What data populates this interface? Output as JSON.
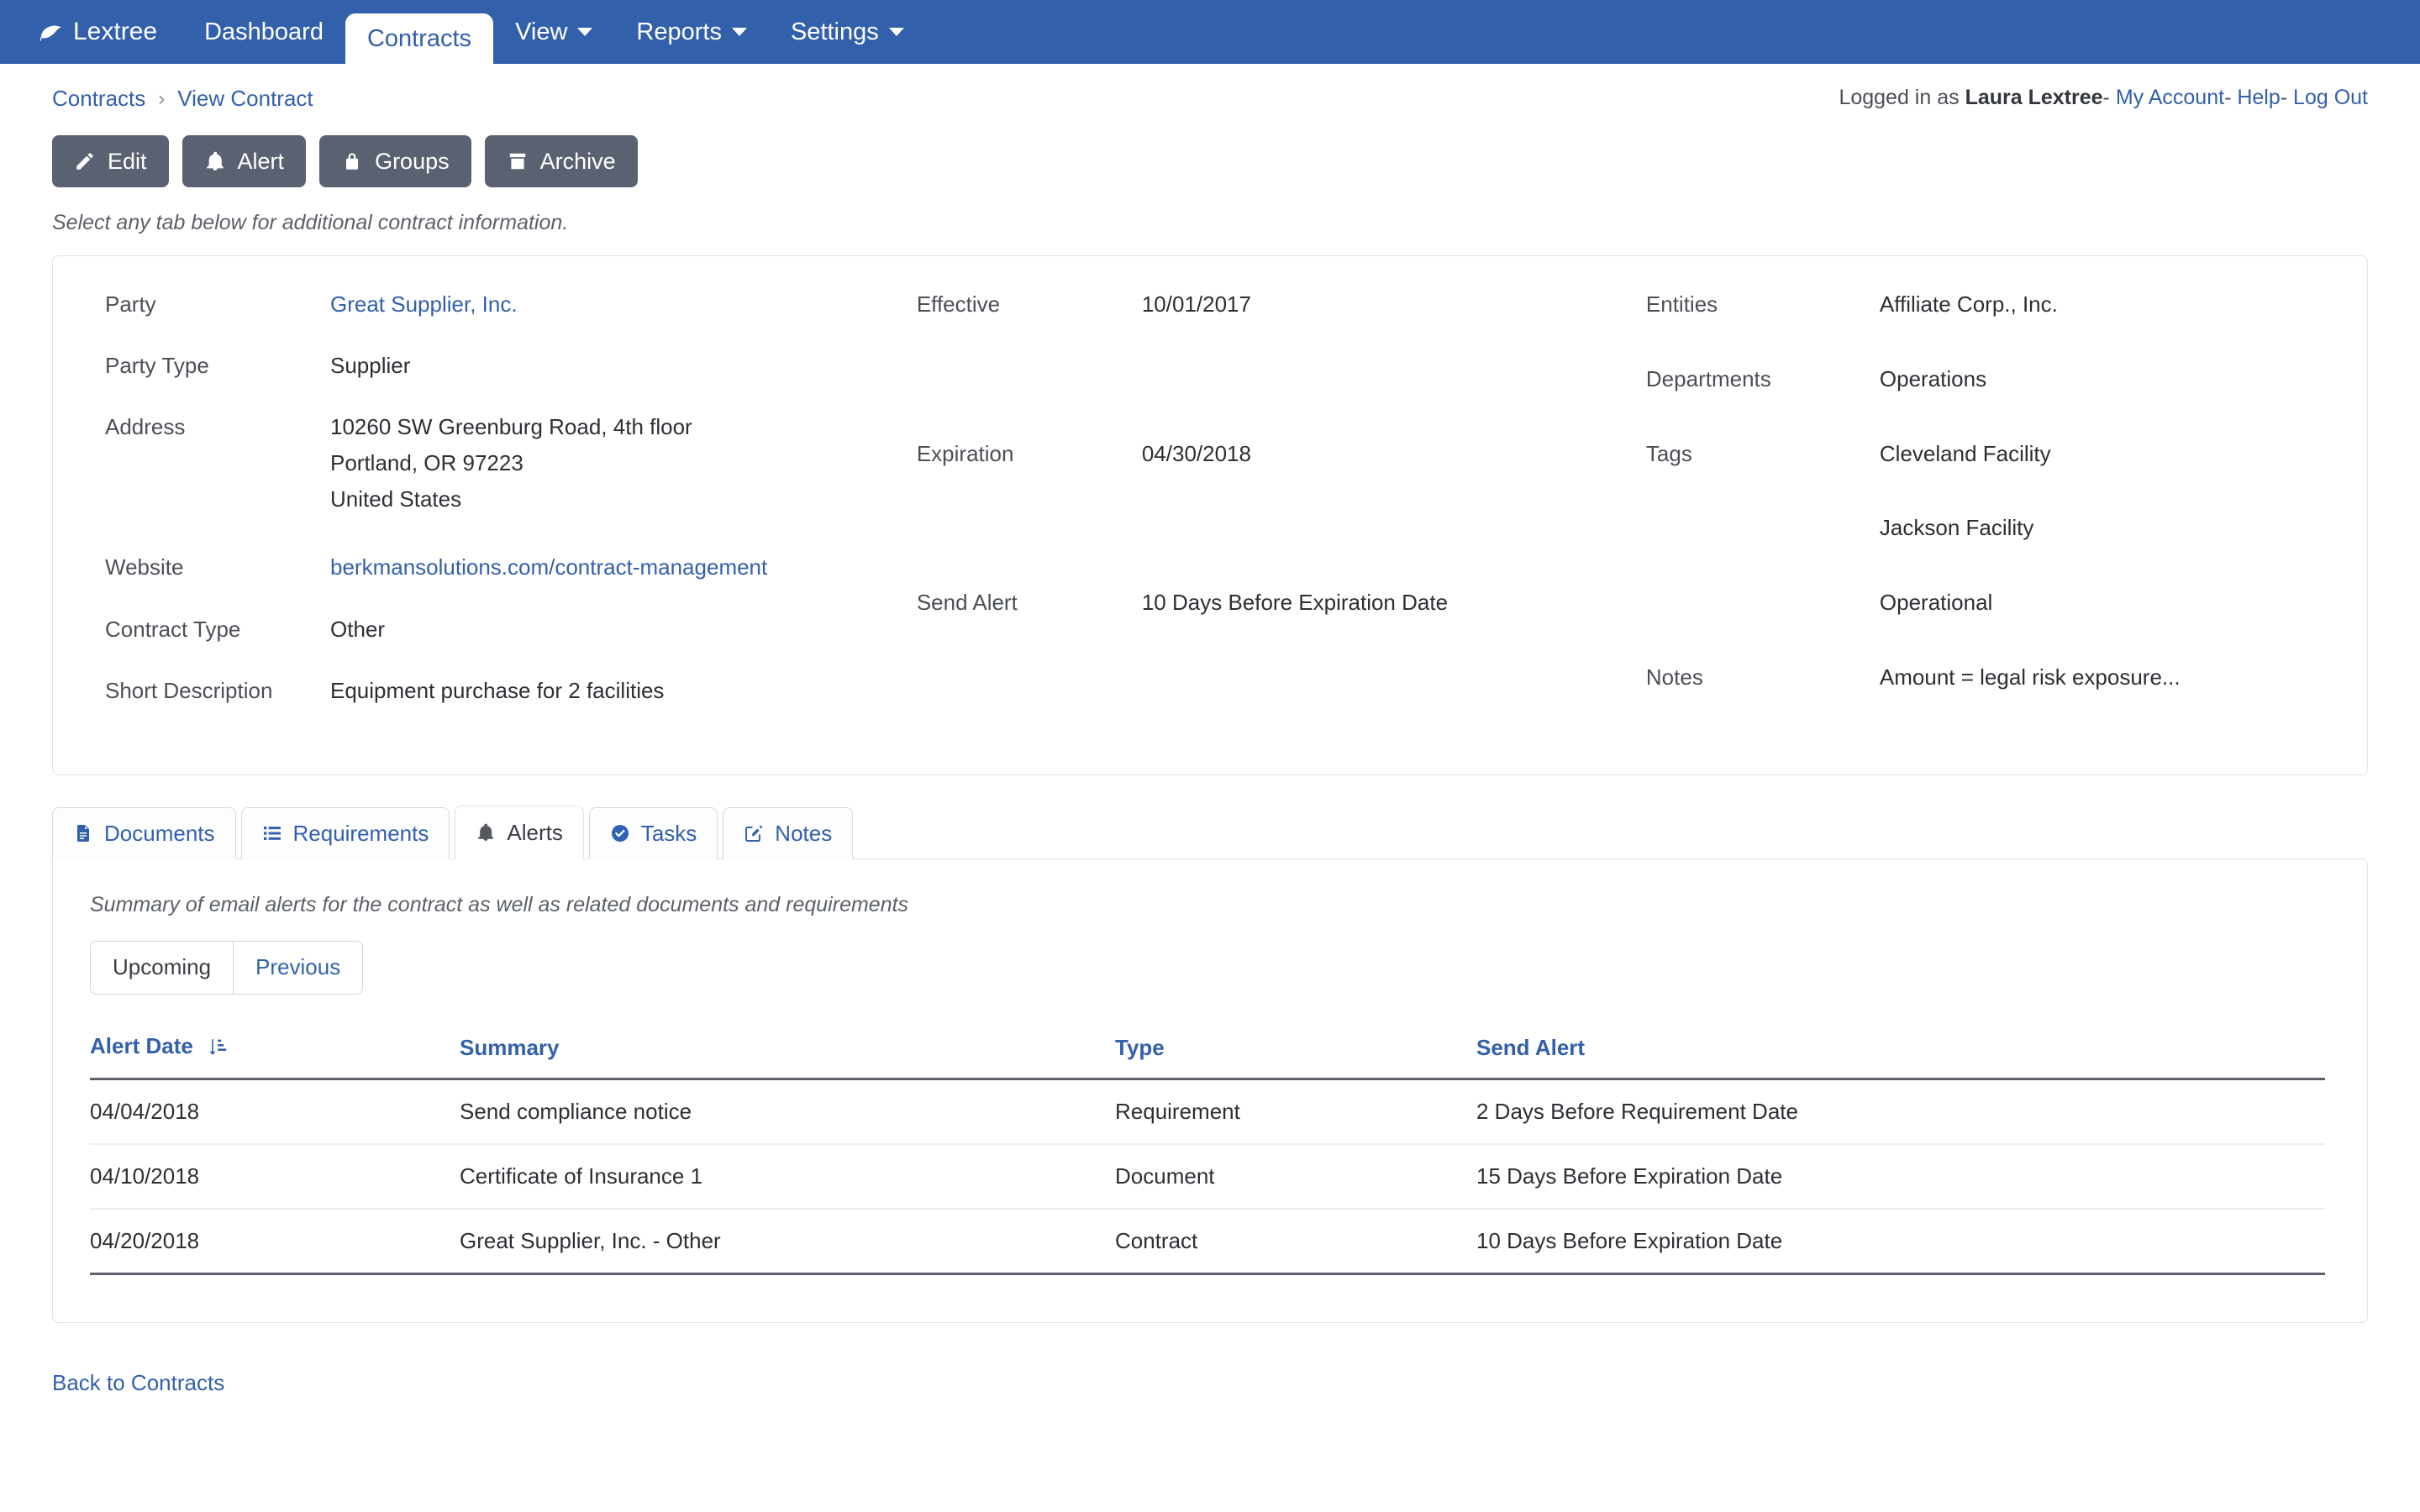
{
  "navbar": {
    "brand": "Lextree",
    "brand_icon": "leaf-icon",
    "accent_color": "#3360ab",
    "items": [
      {
        "label": "Dashboard",
        "active": false,
        "dropdown": false
      },
      {
        "label": "Contracts",
        "active": true,
        "dropdown": false
      },
      {
        "label": "View",
        "active": false,
        "dropdown": true
      },
      {
        "label": "Reports",
        "active": false,
        "dropdown": true
      },
      {
        "label": "Settings",
        "active": false,
        "dropdown": true
      }
    ]
  },
  "breadcrumb": {
    "root": "Contracts",
    "separator": "›",
    "current": "View Contract"
  },
  "account": {
    "prefix": "Logged in as",
    "user": "Laura Lextree",
    "sep": "-",
    "my_account": "My Account",
    "help": "Help",
    "log_out": "Log Out"
  },
  "actions": {
    "buttons": [
      {
        "label": "Edit",
        "icon": "pencil-icon"
      },
      {
        "label": "Alert",
        "icon": "bell-icon"
      },
      {
        "label": "Groups",
        "icon": "lock-icon"
      },
      {
        "label": "Archive",
        "icon": "archive-box-icon"
      }
    ],
    "color": "#5a6170"
  },
  "hint": "Select any tab below for additional contract information.",
  "details": {
    "col1": [
      {
        "label": "Party",
        "value": "Great Supplier, Inc.",
        "link": true
      },
      {
        "label": "Party Type",
        "value": "Supplier"
      },
      {
        "label": "Address",
        "value": [
          "10260 SW Greenburg Road, 4th floor",
          "Portland, OR 97223",
          "United States"
        ]
      },
      {
        "label": "Website",
        "value": "berkmansolutions.com/contract-management",
        "link": true
      },
      {
        "label": "Contract Type",
        "value": "Other"
      },
      {
        "label": "Short Description",
        "value": "Equipment purchase for 2 facilities"
      }
    ],
    "col2": [
      {
        "label": "Effective",
        "value": "10/01/2017"
      },
      {
        "label": "Expiration",
        "value": "04/30/2018"
      },
      {
        "label": "Send Alert",
        "value": "10 Days Before Expiration Date"
      }
    ],
    "col3": [
      {
        "label": "Entities",
        "value": "Affiliate Corp., Inc."
      },
      {
        "label": "Departments",
        "value": "Operations"
      },
      {
        "label": "Tags",
        "value": [
          "Cleveland Facility",
          "Jackson Facility",
          "Operational"
        ]
      },
      {
        "label": "Notes",
        "value": "Amount = legal risk exposure..."
      }
    ]
  },
  "tabs": [
    {
      "label": "Documents",
      "icon": "document-icon",
      "active": false
    },
    {
      "label": "Requirements",
      "icon": "list-icon",
      "active": false
    },
    {
      "label": "Alerts",
      "icon": "bell-icon",
      "active": true
    },
    {
      "label": "Tasks",
      "icon": "check-circle-icon",
      "active": false
    },
    {
      "label": "Notes",
      "icon": "note-edit-icon",
      "active": false
    }
  ],
  "alerts_panel": {
    "description": "Summary of email alerts for the contract as well as related documents and requirements",
    "toggle": [
      {
        "label": "Upcoming",
        "active": true
      },
      {
        "label": "Previous",
        "active": false
      }
    ],
    "columns": [
      {
        "label": "Alert Date",
        "sorted": true,
        "sort_icon": "sort-amount-asc-icon"
      },
      {
        "label": "Summary",
        "sorted": false
      },
      {
        "label": "Type",
        "sorted": false
      },
      {
        "label": "Send Alert",
        "sorted": false
      }
    ],
    "rows": [
      {
        "alert_date": "04/04/2018",
        "summary": "Send compliance notice",
        "type": "Requirement",
        "send_alert": "2 Days Before Requirement Date"
      },
      {
        "alert_date": "04/10/2018",
        "summary": "Certificate of Insurance 1",
        "type": "Document",
        "send_alert": "15 Days Before Expiration Date"
      },
      {
        "alert_date": "04/20/2018",
        "summary": "Great Supplier, Inc. - Other",
        "type": "Contract",
        "send_alert": "10 Days Before Expiration Date"
      }
    ]
  },
  "footer": {
    "back_link": "Back to Contracts"
  }
}
